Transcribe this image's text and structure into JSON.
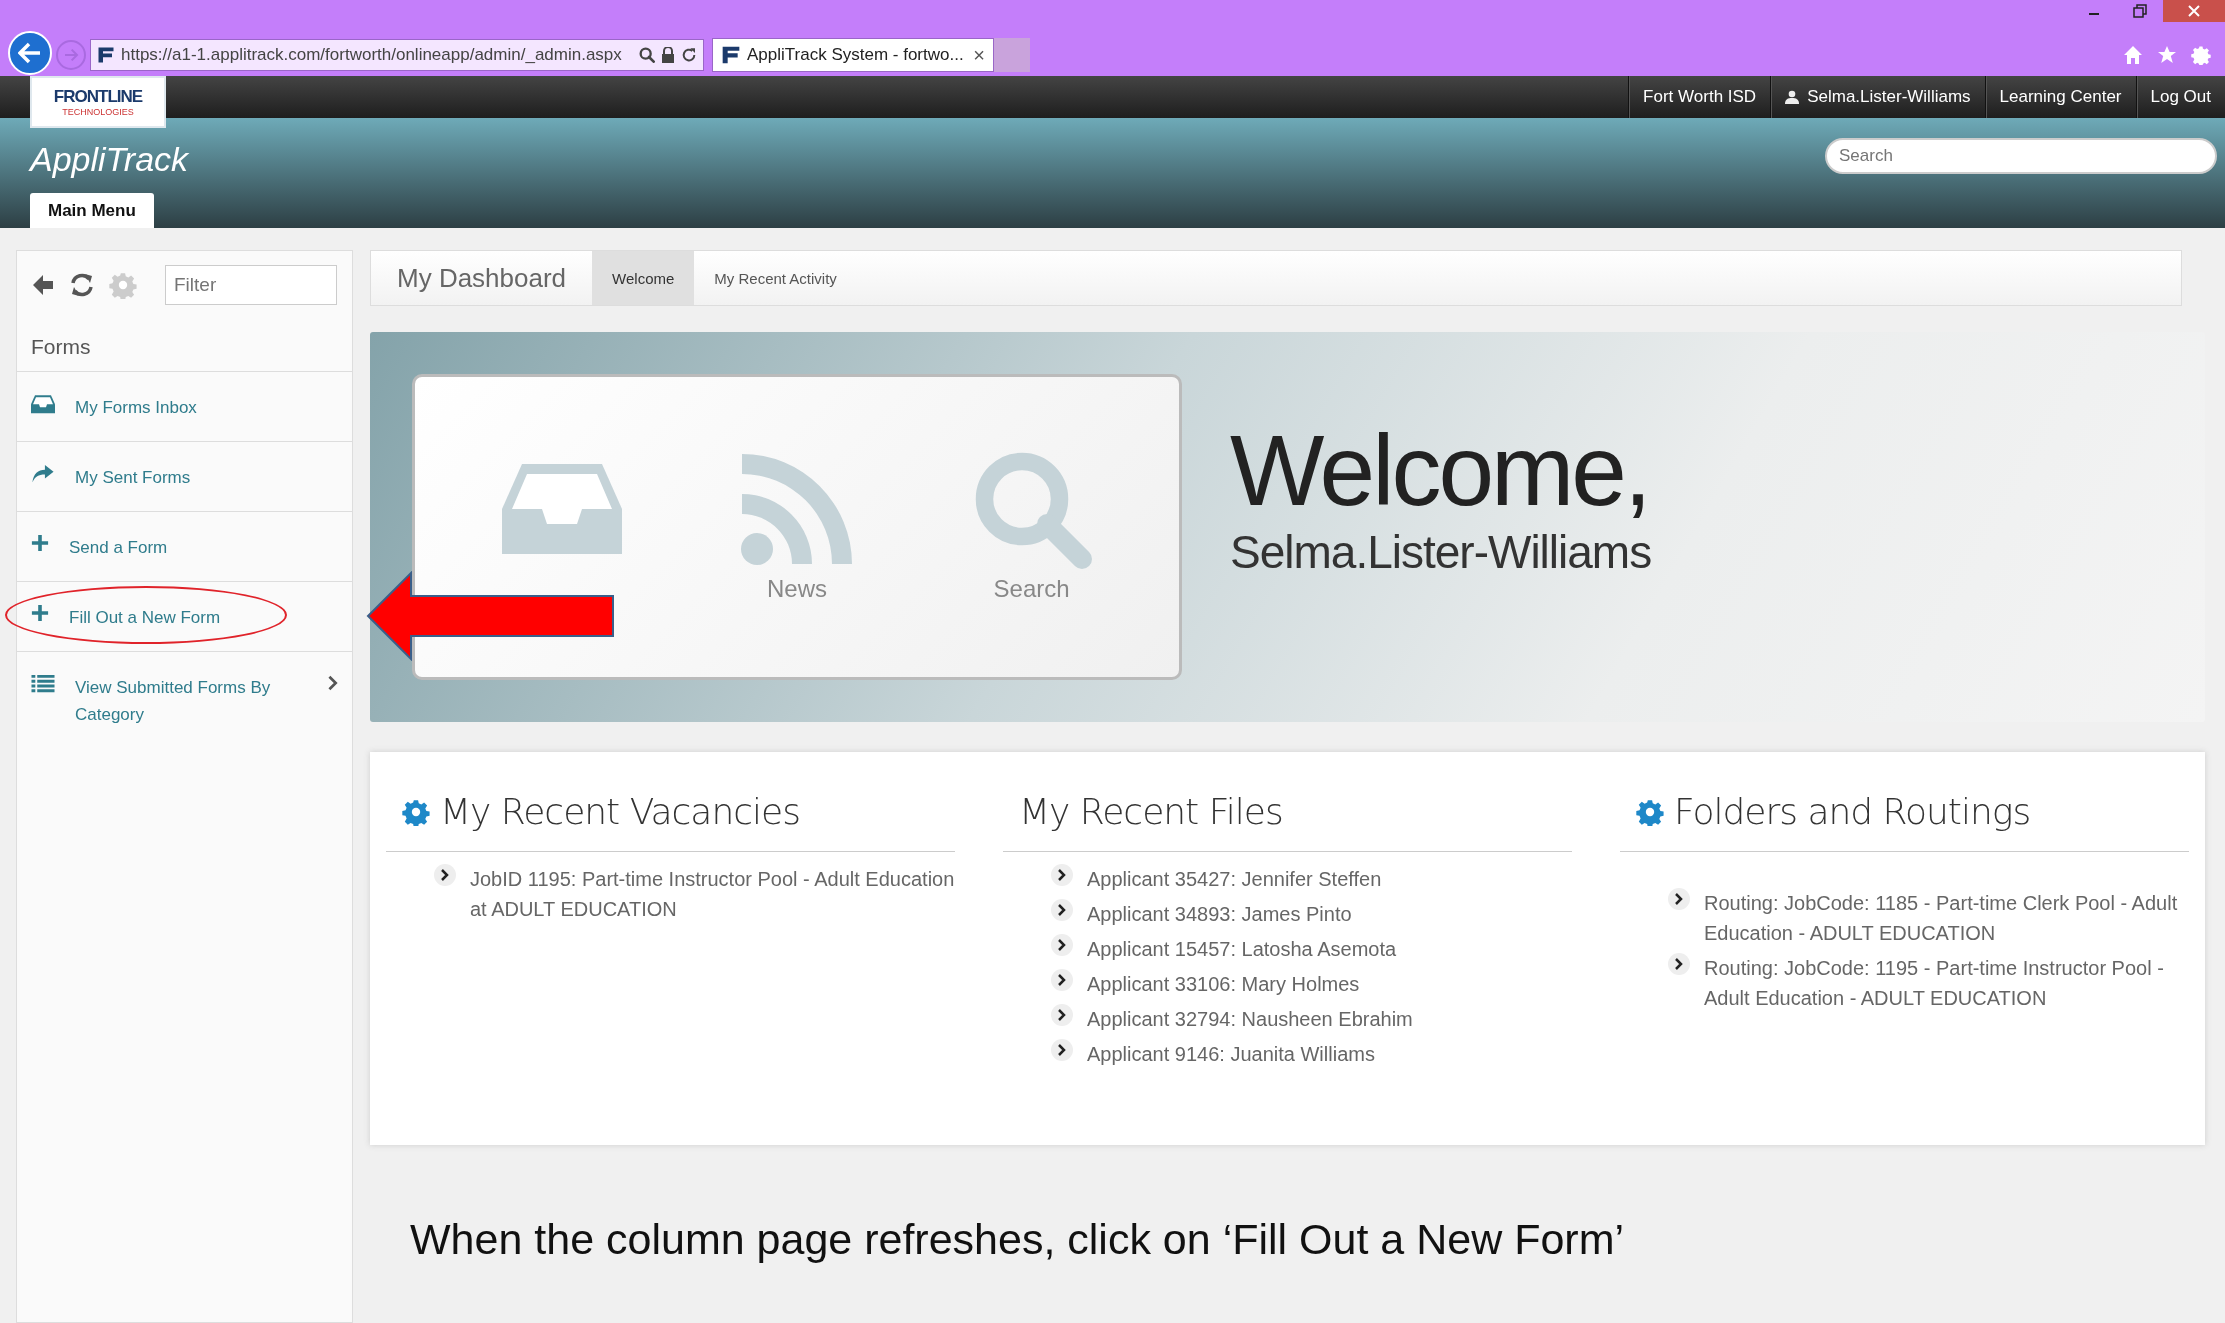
{
  "browser": {
    "address": "https://a1-1.applitrack.com/fortworth/onlineapp/admin/_admin.aspx",
    "tab_title": "AppliTrack System - fortwo...",
    "tab_close": "×"
  },
  "top_nav": [
    {
      "label": "Fort Worth ISD",
      "kind": "text"
    },
    {
      "label": "Selma.Lister-Williams",
      "kind": "user"
    },
    {
      "label": "Learning Center",
      "kind": "text"
    },
    {
      "label": "Log Out",
      "kind": "text"
    }
  ],
  "header": {
    "logo_top": "FRONTLINE",
    "logo_sub": "TECHNOLOGIES",
    "app_name": "AppliTrack",
    "search": {
      "placeholder": "Search"
    },
    "tabs": [
      {
        "label": "Main Menu",
        "selected": true
      }
    ]
  },
  "sidebar": {
    "filter": {
      "placeholder": "Filter"
    },
    "section": "Forms",
    "items": [
      {
        "label": "My Forms Inbox",
        "kind": "inbox",
        "has_children": false,
        "circled": false
      },
      {
        "label": "My Sent Forms",
        "kind": "share",
        "has_children": false,
        "circled": false
      },
      {
        "label": "Send a Form",
        "kind": "plus",
        "has_children": false,
        "circled": false
      },
      {
        "label": "Fill Out a New Form",
        "kind": "plus",
        "has_children": false,
        "circled": true
      },
      {
        "label": "View Submitted Forms By Category",
        "kind": "list",
        "has_children": true,
        "circled": false
      }
    ]
  },
  "dashboard": {
    "title": "My Dashboard",
    "tabs": [
      {
        "label": "Welcome",
        "selected": true
      },
      {
        "label": "My Recent Activity",
        "selected": false
      }
    ]
  },
  "welcome": {
    "tiles": [
      {
        "kind": "inbox"
      },
      {
        "kind": "rss",
        "label": "News"
      },
      {
        "kind": "search",
        "label": "Search"
      }
    ],
    "greeting": "Welcome,",
    "user": "Selma.Lister-Williams"
  },
  "panels": [
    {
      "title": "My Recent Vacancies",
      "gear": true,
      "items": [
        "JobID 1195: Part-time Instructor Pool - Adult Education at ADULT EDUCATION"
      ]
    },
    {
      "title": "My Recent Files",
      "gear": false,
      "items": [
        "Applicant 35427: Jennifer Steffen",
        "Applicant 34893: James Pinto",
        "Applicant 15457: Latosha Asemota",
        "Applicant 33106: Mary Holmes",
        "Applicant 32794: Nausheen Ebrahim",
        "Applicant 9146: Juanita Williams"
      ]
    },
    {
      "title": "Folders and Routings",
      "gear": true,
      "items": [
        "Routing: JobCode: 1185 - Part-time Clerk Pool - Adult Education - ADULT EDUCATION",
        "Routing: JobCode: 1195 - Part-time Instructor Pool - Adult Education - ADULT EDUCATION"
      ]
    }
  ],
  "annotation": {
    "caption": "When the column page refreshes, click on ‘Fill Out a New Form’"
  }
}
